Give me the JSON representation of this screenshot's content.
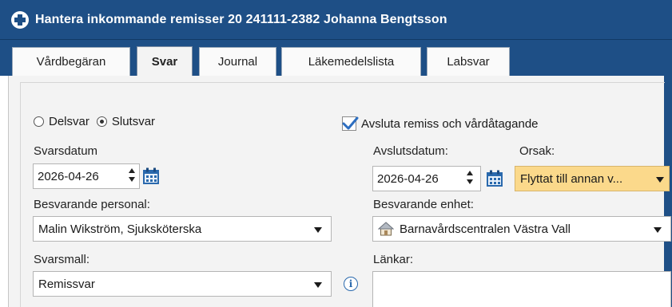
{
  "window": {
    "title": "Hantera inkommande remisser 20 241111-2382 Johanna Bengtsson",
    "logo_icon": "plus-circle-icon"
  },
  "tabs": [
    {
      "label": "Vårdbegäran",
      "active": false
    },
    {
      "label": "Svar",
      "active": true
    },
    {
      "label": "Journal",
      "active": false
    },
    {
      "label": "Läkemedelslista",
      "active": false
    },
    {
      "label": "Labsvar",
      "active": false
    }
  ],
  "form": {
    "response_type": {
      "options": [
        "Delsvar",
        "Slutsvar"
      ],
      "selected": "Slutsvar"
    },
    "close_referral": {
      "label": "Avsluta remiss och vårdåtagande",
      "checked": true
    },
    "svarsdatum": {
      "label": "Svarsdatum",
      "value": "2026-04-26"
    },
    "avslutsdatum": {
      "label": "Avslutsdatum:",
      "value": "2026-04-26"
    },
    "orsak": {
      "label": "Orsak:",
      "value": "Flyttat till annan v..."
    },
    "besvarande_personal": {
      "label": "Besvarande personal:",
      "value": "Malin Wikström, Sjuksköterska"
    },
    "besvarande_enhet": {
      "label": "Besvarande enhet:",
      "value": "Barnavårdscentralen Västra Vall",
      "icon": "house-icon"
    },
    "svarsmall": {
      "label": "Svarsmall:",
      "value": "Remissvar"
    },
    "lankar": {
      "label": "Länkar:",
      "value": ""
    }
  },
  "colors": {
    "titlebar": "#1e4f86",
    "panel_bg": "#f3f3f3",
    "orsak_highlight": "#fbd98b",
    "info_icon": "#2a69ad"
  }
}
